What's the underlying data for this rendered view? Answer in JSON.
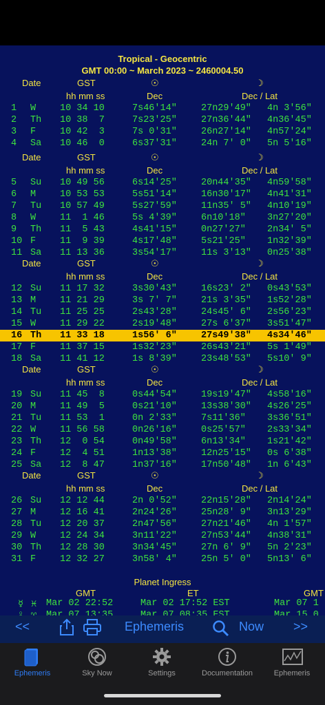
{
  "titles": {
    "line1": "Tropical - Geocentric",
    "line2": "GMT 00:00 ~ March 2023 ~ 2460004.50"
  },
  "headers": {
    "date": "Date",
    "gst": "GST",
    "sun_symbol": "☉",
    "moon_symbol": "☽",
    "hms": "hh mm ss",
    "dec": "Dec",
    "dec_lat": "Dec / Lat"
  },
  "blocks": [
    {
      "rows": [
        {
          "day": "1",
          "wd": "W",
          "gst": "10 34 10",
          "sun": "7s46'14\"",
          "moon": "27n29'49\"",
          "lat": "4n 3'56\""
        },
        {
          "day": "2",
          "wd": "Th",
          "gst": "10 38  7",
          "sun": "7s23'25\"",
          "moon": "27n36'44\"",
          "lat": "4n36'45\""
        },
        {
          "day": "3",
          "wd": "F",
          "gst": "10 42  3",
          "sun": "7s 0'31\"",
          "moon": "26n27'14\"",
          "lat": "4n57'24\""
        },
        {
          "day": "4",
          "wd": "Sa",
          "gst": "10 46  0",
          "sun": "6s37'31\"",
          "moon": "24n 7' 0\"",
          "lat": "5n 5'16\""
        }
      ]
    },
    {
      "rows": [
        {
          "day": "5",
          "wd": "Su",
          "gst": "10 49 56",
          "sun": "6s14'25\"",
          "moon": "20n44'35\"",
          "lat": "4n59'58\""
        },
        {
          "day": "6",
          "wd": "M",
          "gst": "10 53 53",
          "sun": "5s51'14\"",
          "moon": "16n30'17\"",
          "lat": "4n41'31\""
        },
        {
          "day": "7",
          "wd": "Tu",
          "gst": "10 57 49",
          "sun": "5s27'59\"",
          "moon": "11n35' 5\"",
          "lat": "4n10'19\""
        },
        {
          "day": "8",
          "wd": "W",
          "gst": "11  1 46",
          "sun": "5s 4'39\"",
          "moon": "6n10'18\"",
          "lat": "3n27'20\""
        },
        {
          "day": "9",
          "wd": "Th",
          "gst": "11  5 43",
          "sun": "4s41'15\"",
          "moon": "0n27'27\"",
          "lat": "2n34' 5\""
        },
        {
          "day": "10",
          "wd": "F",
          "gst": "11  9 39",
          "sun": "4s17'48\"",
          "moon": "5s21'25\"",
          "lat": "1n32'39\""
        },
        {
          "day": "11",
          "wd": "Sa",
          "gst": "11 13 36",
          "sun": "3s54'17\"",
          "moon": "11s 3'13\"",
          "lat": "0n25'38\""
        }
      ]
    },
    {
      "rows": [
        {
          "day": "12",
          "wd": "Su",
          "gst": "11 17 32",
          "sun": "3s30'43\"",
          "moon": "16s23' 2\"",
          "lat": "0s43'53\""
        },
        {
          "day": "13",
          "wd": "M",
          "gst": "11 21 29",
          "sun": "3s 7' 7\"",
          "moon": "21s 3'35\"",
          "lat": "1s52'28\""
        },
        {
          "day": "14",
          "wd": "Tu",
          "gst": "11 25 25",
          "sun": "2s43'28\"",
          "moon": "24s45' 6\"",
          "lat": "2s56'23\""
        },
        {
          "day": "15",
          "wd": "W",
          "gst": "11 29 22",
          "sun": "2s19'48\"",
          "moon": "27s 6'37\"",
          "lat": "3s51'47\""
        },
        {
          "day": "16",
          "wd": "Th",
          "gst": "11 33 18",
          "sun": "1s56' 6\"",
          "moon": "27s49'38\"",
          "lat": "4s34'46\"",
          "highlight": true
        },
        {
          "day": "17",
          "wd": "F",
          "gst": "11 37 15",
          "sun": "1s32'23\"",
          "moon": "26s43'21\"",
          "lat": "5s 1'49\""
        },
        {
          "day": "18",
          "wd": "Sa",
          "gst": "11 41 12",
          "sun": "1s 8'39\"",
          "moon": "23s48'53\"",
          "lat": "5s10' 9\""
        }
      ]
    },
    {
      "rows": [
        {
          "day": "19",
          "wd": "Su",
          "gst": "11 45  8",
          "sun": "0s44'54\"",
          "moon": "19s19'47\"",
          "lat": "4s58'16\""
        },
        {
          "day": "20",
          "wd": "M",
          "gst": "11 49  5",
          "sun": "0s21'10\"",
          "moon": "13s38'30\"",
          "lat": "4s26'25\""
        },
        {
          "day": "21",
          "wd": "Tu",
          "gst": "11 53  1",
          "sun": "0n 2'33\"",
          "moon": "7s11'36\"",
          "lat": "3s36'51\""
        },
        {
          "day": "22",
          "wd": "W",
          "gst": "11 56 58",
          "sun": "0n26'16\"",
          "moon": "0s25'57\"",
          "lat": "2s33'34\""
        },
        {
          "day": "23",
          "wd": "Th",
          "gst": "12  0 54",
          "sun": "0n49'58\"",
          "moon": "6n13'34\"",
          "lat": "1s21'42\""
        },
        {
          "day": "24",
          "wd": "F",
          "gst": "12  4 51",
          "sun": "1n13'38\"",
          "moon": "12n25'15\"",
          "lat": "0s 6'38\""
        },
        {
          "day": "25",
          "wd": "Sa",
          "gst": "12  8 47",
          "sun": "1n37'16\"",
          "moon": "17n50'48\"",
          "lat": "1n 6'43\""
        }
      ]
    },
    {
      "rows": [
        {
          "day": "26",
          "wd": "Su",
          "gst": "12 12 44",
          "sun": "2n 0'52\"",
          "moon": "22n15'28\"",
          "lat": "2n14'24\""
        },
        {
          "day": "27",
          "wd": "M",
          "gst": "12 16 41",
          "sun": "2n24'26\"",
          "moon": "25n28' 9\"",
          "lat": "3n13'29\""
        },
        {
          "day": "28",
          "wd": "Tu",
          "gst": "12 20 37",
          "sun": "2n47'56\"",
          "moon": "27n21'46\"",
          "lat": "4n 1'57\""
        },
        {
          "day": "29",
          "wd": "W",
          "gst": "12 24 34",
          "sun": "3n11'22\"",
          "moon": "27n53'44\"",
          "lat": "4n38'31\""
        },
        {
          "day": "30",
          "wd": "Th",
          "gst": "12 28 30",
          "sun": "3n34'45\"",
          "moon": "27n 6' 9\"",
          "lat": "5n 2'23\""
        },
        {
          "day": "31",
          "wd": "F",
          "gst": "12 32 27",
          "sun": "3n58' 4\"",
          "moon": "25n 5' 0\"",
          "lat": "5n13' 6\""
        }
      ]
    }
  ],
  "ingress": {
    "title": "Planet Ingress",
    "gmt_label": "GMT",
    "et_label": "ET",
    "gmt_label2": "GMT",
    "rows": [
      {
        "planet": "☿",
        "sign": "♓",
        "gmt": "Mar 02 22:52",
        "et": "Mar 02 17:52 EST",
        "gmt2": "Mar 07 1"
      },
      {
        "planet": "♀",
        "sign": "♈",
        "gmt": "Mar 07 13:35",
        "et": "Mar 07 08:35 EST",
        "gmt2": "Mar 15 0"
      }
    ]
  },
  "toolbar": {
    "prev": "<<",
    "title": "Ephemeris",
    "now": "Now",
    "next": ">>"
  },
  "tabs": [
    {
      "label": "Ephemeris",
      "active": true
    },
    {
      "label": "Sky Now"
    },
    {
      "label": "Settings"
    },
    {
      "label": "Documentation"
    },
    {
      "label": "Ephemeris"
    }
  ],
  "colors": {
    "background": "#07125c",
    "data": "#3ee33e",
    "header": "#f4e542",
    "highlight": "#f7c400",
    "accent": "#2f7df6"
  }
}
